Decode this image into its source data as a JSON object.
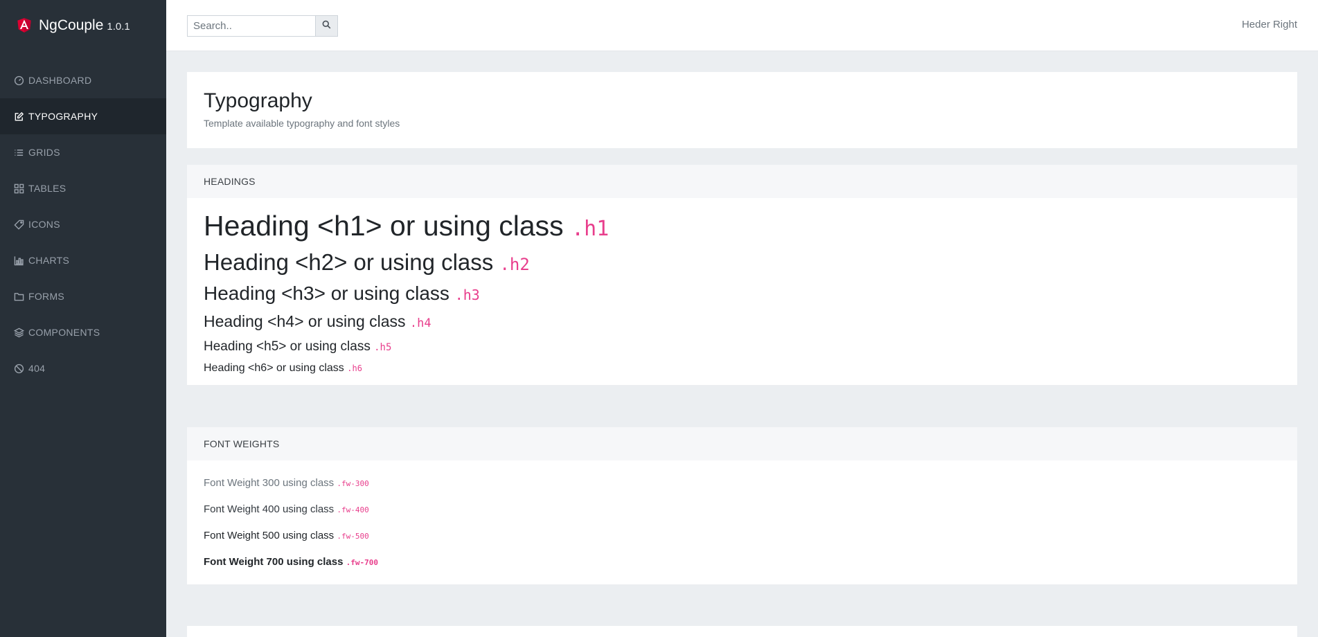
{
  "brand": {
    "name": "NgCouple",
    "version": "1.0.1"
  },
  "sidebar": {
    "items": [
      {
        "label": "DASHBOARD",
        "icon": "dashboard-icon"
      },
      {
        "label": "TYPOGRAPHY",
        "icon": "edit-icon",
        "active": true
      },
      {
        "label": "GRIDS",
        "icon": "list-icon"
      },
      {
        "label": "TABLES",
        "icon": "grid-icon"
      },
      {
        "label": "ICONS",
        "icon": "tag-icon"
      },
      {
        "label": "CHARTS",
        "icon": "bar-chart-icon"
      },
      {
        "label": "FORMS",
        "icon": "folder-icon"
      },
      {
        "label": "COMPONENTS",
        "icon": "layers-icon"
      },
      {
        "label": "404",
        "icon": "ban-icon"
      }
    ]
  },
  "header": {
    "search_placeholder": "Search..",
    "search_value": "",
    "right_text": "Heder Right"
  },
  "page": {
    "title": "Typography",
    "subtitle": "Template available typography and font styles"
  },
  "headings": {
    "header": "HEADINGS",
    "rows": [
      {
        "text": "Heading <h1> or using class",
        "code": ".h1"
      },
      {
        "text": "Heading <h2> or using class",
        "code": ".h2"
      },
      {
        "text": "Heading <h3> or using class",
        "code": ".h3"
      },
      {
        "text": "Heading <h4> or using class",
        "code": ".h4"
      },
      {
        "text": "Heading <h5> or using class",
        "code": ".h5"
      },
      {
        "text": "Heading <h6> or using class",
        "code": ".h6"
      }
    ]
  },
  "weights": {
    "header": "FONT WEIGHTS",
    "rows": [
      {
        "text": "Font Weight 300 using class",
        "code": ".fw-300"
      },
      {
        "text": "Font Weight 400 using class",
        "code": ".fw-400"
      },
      {
        "text": "Font Weight 500 using class",
        "code": ".fw-500"
      },
      {
        "text": "Font Weight 700 using class",
        "code": ".fw-700"
      }
    ]
  },
  "colors": {
    "sidebar_bg": "#283038",
    "sidebar_active_bg": "#1f262d",
    "brand_logo": "#dd0031",
    "code_pink": "#e83e8c",
    "content_bg": "#ebeef1"
  }
}
